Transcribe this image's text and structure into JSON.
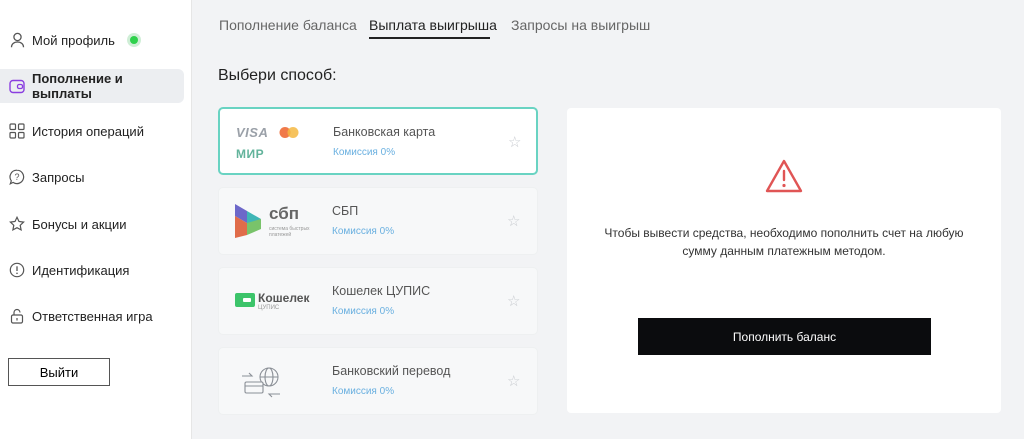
{
  "sidebar": {
    "items": [
      {
        "label": "Мой профиль"
      },
      {
        "label": "Пополнение и выплаты"
      },
      {
        "label": "История операций"
      },
      {
        "label": "Запросы"
      },
      {
        "label": "Бонусы и акции"
      },
      {
        "label": "Идентификация"
      },
      {
        "label": "Ответственная игра"
      }
    ],
    "logout": "Выйти"
  },
  "tabs": [
    "Пополнение баланса",
    "Выплата выигрыша",
    "Запросы на выигрыш"
  ],
  "heading": "Выбери способ:",
  "methods": [
    {
      "name": "Банковская карта",
      "commission": "Комиссия 0%",
      "logo_visa": "VISA",
      "logo_mir": "МИР"
    },
    {
      "name": "СБП",
      "commission": "Комиссия 0%",
      "logo_text": "сбп",
      "logo_sub": "система быстрых платежей"
    },
    {
      "name": "Кошелек ЦУПИС",
      "commission": "Комиссия 0%",
      "logo_text": "Кошелек",
      "logo_sub": "ЦУПИС"
    },
    {
      "name": "Банковский перевод",
      "commission": "Комиссия 0%"
    }
  ],
  "panel": {
    "message": "Чтобы вывести средства, необходимо пополнить счет на любую сумму данным платежным методом.",
    "button": "Пополнить баланс"
  },
  "colors": {
    "online": "#2ed14c",
    "selected_border": "#69d3c2",
    "warning": "#e05555",
    "commission": "#6ab0e0"
  }
}
